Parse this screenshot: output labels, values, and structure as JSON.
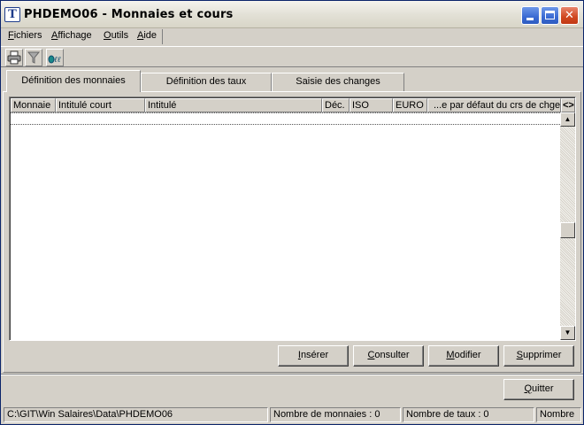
{
  "window": {
    "title": "PHDEMO06 - Monnaies et cours",
    "icon_label": "T"
  },
  "menu": {
    "items": [
      "Fichiers",
      "Affichage",
      "Outils",
      "Aide"
    ]
  },
  "toolbar": {
    "icons": [
      "printer-icon",
      "filter-icon",
      "calculator-icon"
    ]
  },
  "tabs": [
    {
      "label": "Définition des monnaies",
      "active": true
    },
    {
      "label": "Définition des taux",
      "active": false
    },
    {
      "label": "Saisie des changes",
      "active": false
    }
  ],
  "grid": {
    "columns": [
      "Monnaie",
      "Intitulé court",
      "Intitulé",
      "Déc.",
      "ISO",
      "EURO",
      "...e par défaut du crs de chge"
    ],
    "scroll_toggle": "<>",
    "rows": []
  },
  "actions": {
    "insert": "Insérer",
    "view": "Consulter",
    "edit": "Modifier",
    "delete": "Supprimer",
    "quit": "Quitter"
  },
  "status": {
    "path": "C:\\GIT\\Win Salaires\\Data\\PHDEMO06",
    "currencies_count": "Nombre de monnaies : 0",
    "rates_count": "Nombre de taux : 0",
    "truncated": "Nombre"
  },
  "colors": {
    "face": "#d4d0c8",
    "titlebar_button": "#3a6ad2",
    "close_button": "#d0471f"
  }
}
